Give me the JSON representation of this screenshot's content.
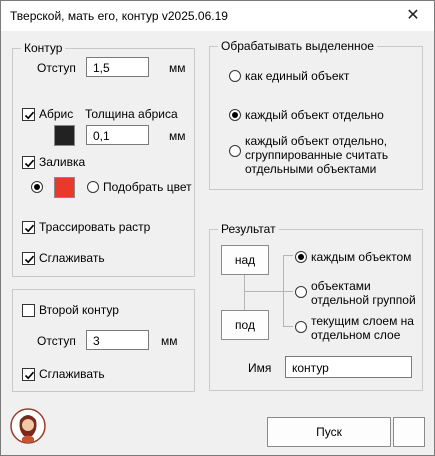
{
  "window": {
    "title": "Тверской, мать его, контур v2025.06.19"
  },
  "contour": {
    "group_label": "Контур",
    "offset_label": "Отступ",
    "offset_value": "1,5",
    "offset_unit": "мм",
    "outline_label": "Абрис",
    "outline_thickness_label": "Толщина абриса",
    "outline_thickness_value": "0,1",
    "outline_unit": "мм",
    "outline_color": "#222222",
    "fill_label": "Заливка",
    "fill_color": "#e8392a",
    "pick_color_label": "Подобрать цвет",
    "trace_raster_label": "Трассировать растр",
    "smooth_label": "Сглаживать"
  },
  "second_contour": {
    "label": "Второй контур",
    "offset_label": "Отступ",
    "offset_value": "3",
    "offset_unit": "мм",
    "smooth_label": "Сглаживать"
  },
  "process_selected": {
    "group_label": "Обрабатывать выделенное",
    "options": [
      "как единый объект",
      "каждый объект отдельно",
      "каждый объект отдельно, сгруппированные считать отдельными объектами"
    ],
    "selected_index": 1
  },
  "result": {
    "group_label": "Результат",
    "above_button": "над",
    "below_button": "под",
    "options": [
      "каждым объектом",
      "объектами отдельной группой",
      "текущим слоем на отдельном слое"
    ],
    "selected_index": 0,
    "name_label": "Имя",
    "name_value": "контур"
  },
  "footer": {
    "run_button": "Пуск"
  }
}
